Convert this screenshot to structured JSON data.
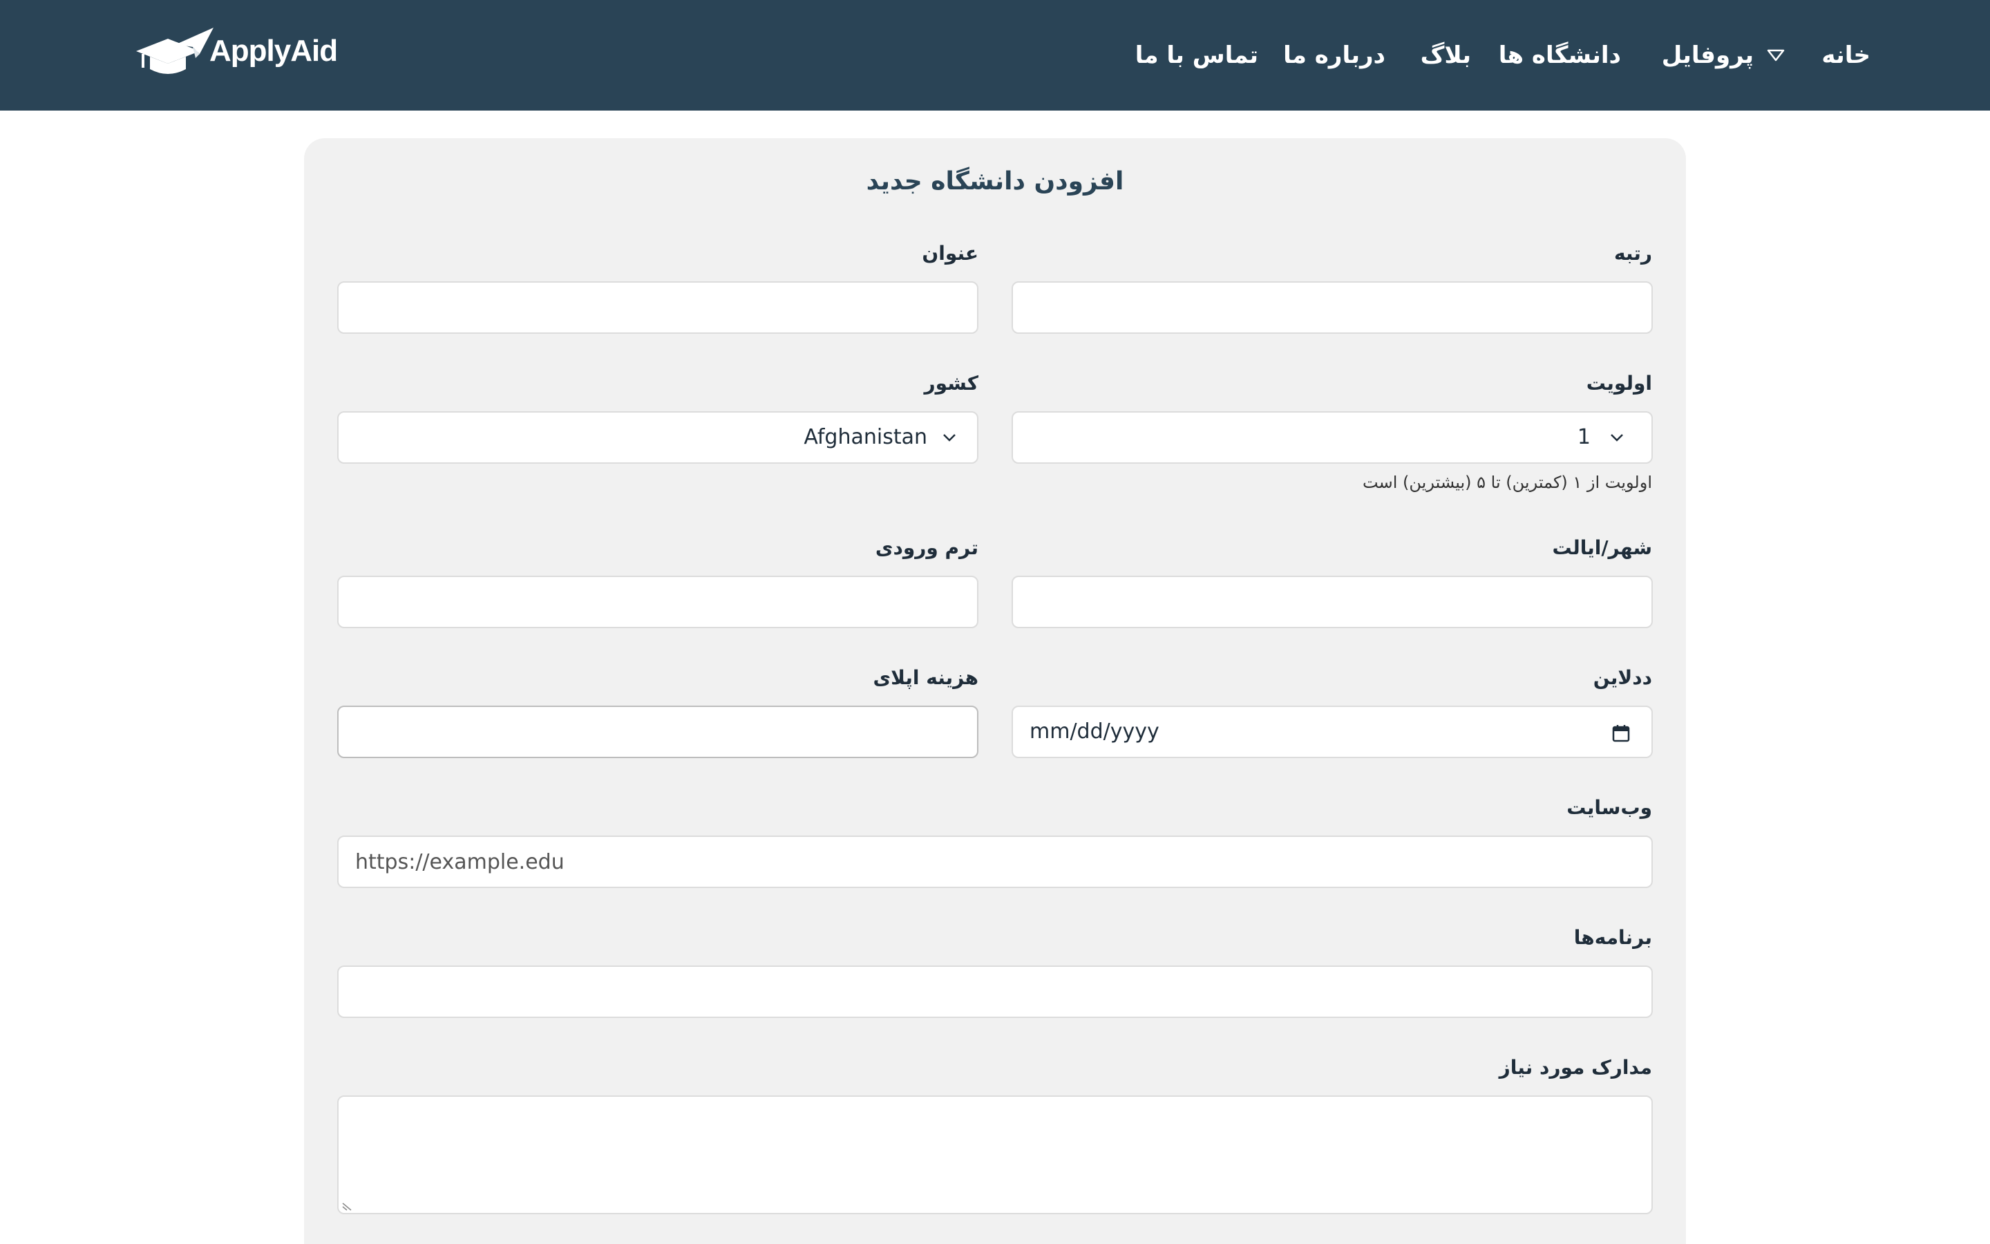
{
  "brand": {
    "name": "ApplyAid",
    "logo_icon": "graduation-cap-paper-plane-icon"
  },
  "nav": {
    "home": "خانه",
    "profile": "پروفایل",
    "universities": "دانشگاه ها",
    "blog": "بلاگ",
    "about": "درباره ما",
    "contact": "تماس با ما"
  },
  "form": {
    "title": "افزودن دانشگاه جدید",
    "rank_label": "رتبه",
    "title_label": "عنوان",
    "priority_label": "اولویت",
    "priority_value": "1",
    "priority_hint": "اولویت از ۱ (کمترین) تا ۵ (بیشترین) است",
    "country_label": "کشور",
    "country_value": "Afghanistan",
    "city_label": "شهر/ایالت",
    "term_label": "ترم ورودی",
    "deadline_label": "ددلاین",
    "deadline_placeholder": "mm/dd/yyyy",
    "fee_label": "هزینه اپلای",
    "website_label": "وب‌سایت",
    "website_placeholder": "https://example.edu",
    "programs_label": "برنامه‌ها",
    "documents_label": "مدارک مورد نیاز"
  },
  "colors": {
    "navbar": "#2a4456",
    "card": "#f1f1f1",
    "title": "#2a4456"
  }
}
